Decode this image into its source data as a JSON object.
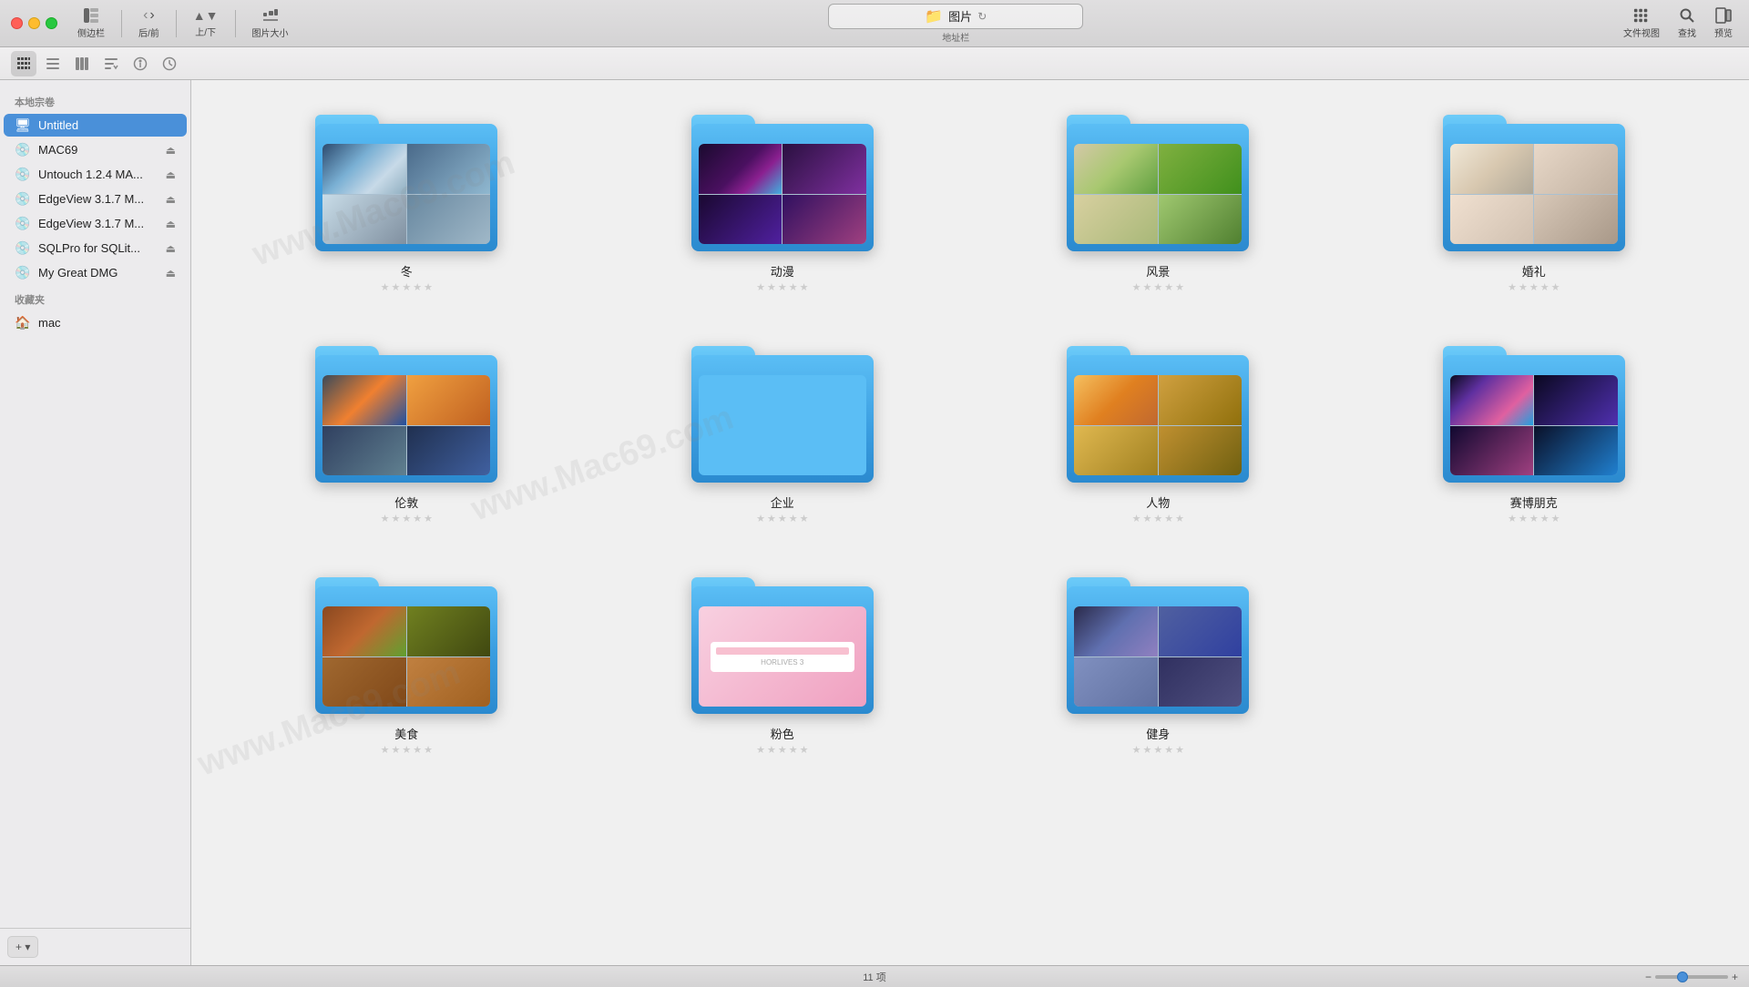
{
  "titlebar": {
    "title": "图片",
    "subtitle": "地址栏",
    "sidebar_label": "侧边栏",
    "back_forward_label": "后/前",
    "size_label": "图片大小",
    "up_down_label": "上/下",
    "refresh_label": "刷新",
    "view_label": "文件视图",
    "search_label": "查找",
    "preview_label": "预览"
  },
  "sidebar": {
    "section1_label": "本地宗卷",
    "section2_label": "收藏夹",
    "items_local": [
      {
        "id": "untitled",
        "label": "Untitled",
        "icon": "🖥",
        "eject": false,
        "active": true
      },
      {
        "id": "mac69",
        "label": "MAC69",
        "icon": "💿",
        "eject": true,
        "active": false
      },
      {
        "id": "untouch",
        "label": "Untouch 1.2.4 MA...",
        "icon": "💿",
        "eject": true,
        "active": false
      },
      {
        "id": "edgeview1",
        "label": "EdgeView 3.1.7 M...",
        "icon": "💿",
        "eject": true,
        "active": false
      },
      {
        "id": "edgeview2",
        "label": "EdgeView 3.1.7 M...",
        "icon": "💿",
        "eject": true,
        "active": false
      },
      {
        "id": "sqlpro",
        "label": "SQLPro for SQLit...",
        "icon": "💿",
        "eject": true,
        "active": false
      },
      {
        "id": "dmg",
        "label": "My Great DMG",
        "icon": "💿",
        "eject": true,
        "active": false
      }
    ],
    "items_favorites": [
      {
        "id": "mac",
        "label": "mac",
        "icon": "🏠",
        "eject": false,
        "active": false
      }
    ],
    "add_button_label": "+ ▾"
  },
  "folders": [
    {
      "id": "winter",
      "name": "冬",
      "img_type": "winter",
      "has_images": true,
      "row": 0
    },
    {
      "id": "anime",
      "name": "动漫",
      "img_type": "anime",
      "has_images": true,
      "row": 0
    },
    {
      "id": "landscape",
      "name": "风景",
      "img_type": "landscape",
      "has_images": true,
      "row": 0
    },
    {
      "id": "wedding",
      "name": "婚礼",
      "img_type": "wedding",
      "has_images": true,
      "row": 0
    },
    {
      "id": "london",
      "name": "伦敦",
      "img_type": "london",
      "has_images": true,
      "row": 1
    },
    {
      "id": "enterprise",
      "name": "企业",
      "img_type": "empty",
      "has_images": false,
      "row": 1
    },
    {
      "id": "people",
      "name": "人物",
      "img_type": "people",
      "has_images": true,
      "row": 1
    },
    {
      "id": "cyberpunk",
      "name": "赛博朋克",
      "img_type": "cyberpunk",
      "has_images": true,
      "row": 1
    },
    {
      "id": "food",
      "name": "美食",
      "img_type": "food",
      "has_images": true,
      "row": 2
    },
    {
      "id": "pink",
      "name": "粉色",
      "img_type": "pink",
      "has_images": true,
      "row": 2
    },
    {
      "id": "fitness",
      "name": "健身",
      "img_type": "fitness",
      "has_images": true,
      "row": 2
    }
  ],
  "statusbar": {
    "count_label": "11 项"
  },
  "watermark_text": "www.Mac69.com"
}
